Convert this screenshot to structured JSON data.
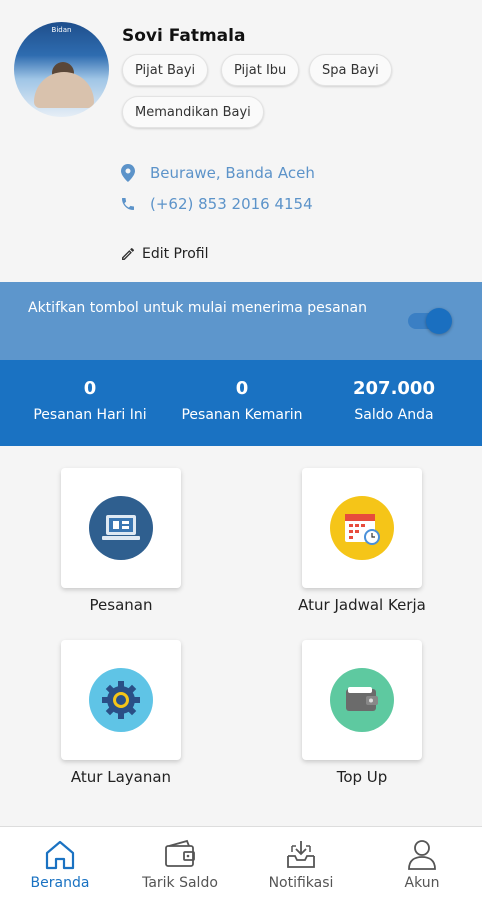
{
  "profile": {
    "name": "Sovi Fatmala",
    "avatar_brand": "Bidan",
    "services": [
      "Pijat Bayi",
      "Pijat Ibu",
      "Spa Bayi",
      "Memandikan Bayi"
    ],
    "location": "Beurawe, Banda Aceh",
    "phone": "(+62) 853 2016 4154",
    "edit_label": "Edit Profil"
  },
  "activate": {
    "text": "Aktifkan tombol untuk mulai menerima pesanan",
    "toggle_on": true
  },
  "stats": [
    {
      "value": "0",
      "label": "Pesanan Hari Ini"
    },
    {
      "value": "0",
      "label": "Pesanan Kemarin"
    },
    {
      "value": "207.000",
      "label": "Saldo Anda"
    }
  ],
  "menu": [
    {
      "label": "Pesanan",
      "icon": "laptop-icon",
      "color": "#2f5f8f"
    },
    {
      "label": "Atur Jadwal Kerja",
      "icon": "calendar-icon",
      "color": "#f5c518"
    },
    {
      "label": "Atur Layanan",
      "icon": "gear-icon",
      "color": "#5fc4e6"
    },
    {
      "label": "Top Up",
      "icon": "wallet-icon",
      "color": "#5ec9a0"
    }
  ],
  "bottom_nav": [
    {
      "label": "Beranda",
      "icon": "home-icon",
      "active": true
    },
    {
      "label": "Tarik Saldo",
      "icon": "wallet-icon",
      "active": false
    },
    {
      "label": "Notifikasi",
      "icon": "inbox-icon",
      "active": false
    },
    {
      "label": "Akun",
      "icon": "user-icon",
      "active": false
    }
  ],
  "colors": {
    "primary": "#1a72c2",
    "banner": "#5d96cc",
    "link": "#5c93c9"
  }
}
